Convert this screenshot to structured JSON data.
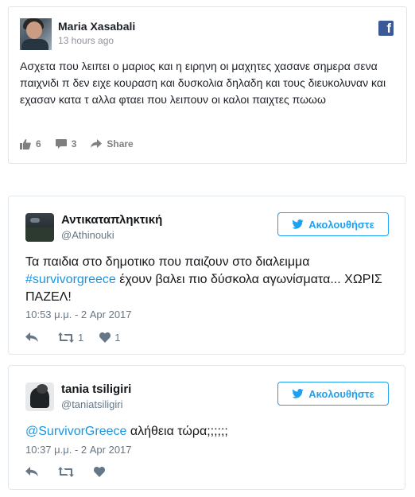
{
  "facebook_post": {
    "author": "Maria Xasabali",
    "time": "13 hours ago",
    "logo_letter": "f",
    "text": "Ασχετα που λειπει ο μαριος και η ειρηνη οι μαχητες χασανε σημερα σενα παιχνιδι π δεν ειχε κουραση και δυσκολια δηλαδη και τους διευκολυναν και εχασαν κατα τ αλλα φταει που λειπουν οι καλοι παιχτες πωωω",
    "likes": "6",
    "comments": "3",
    "share_label": "Share"
  },
  "tweets": [
    {
      "name": "Αντικαταπληκτική",
      "handle": "@Athinouki",
      "follow_label": "Ακολουθήστε",
      "text_before": "Τα παιδια στο δημοτικο που παιζουν στο διαλειμμα",
      "hashtag": "#survivorgreece",
      "text_after": " έχουν βαλει πιο δύσκολα αγωνίσματα... ΧΩΡΙΣ ΠΑΖΕΛ!",
      "date": "10:53 μ.μ. - 2 Apr 2017",
      "retweets": "1",
      "likes": "1"
    },
    {
      "name": "tania tsiligiri",
      "handle": "@taniatsiligiri",
      "follow_label": "Ακολουθήστε",
      "mention": "@SurvivorGreece",
      "text_after": " αλήθεια τώρα;;;;;;",
      "date": "10:37 μ.μ. - 2 Apr 2017"
    }
  ],
  "colors": {
    "facebook_blue": "#3b5998",
    "twitter_blue": "#1da1f2",
    "link_blue": "#1b95e0",
    "muted": "#657786"
  }
}
